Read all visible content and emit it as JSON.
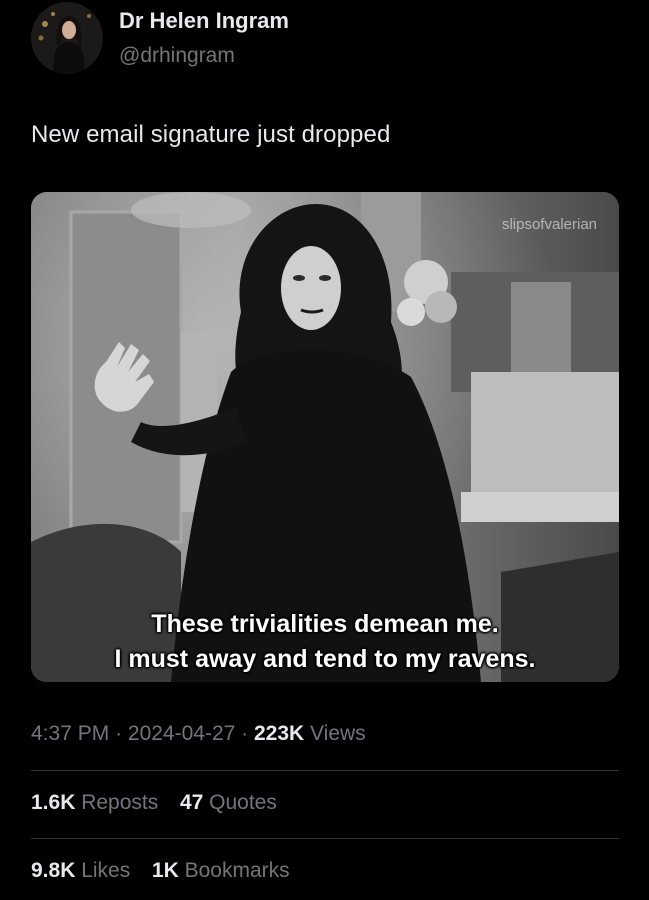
{
  "author": {
    "display_name": "Dr Helen Ingram",
    "handle": "@drhingram"
  },
  "tweet": {
    "text": "New email signature just dropped",
    "media": {
      "watermark": "slipsofvalerian",
      "caption_line1": "These trivialities demean me.",
      "caption_line2": "I must away and tend to my ravens."
    },
    "time": "4:37 PM",
    "date": "2024-04-27",
    "views_count": "223K",
    "views_label": "Views"
  },
  "stats": {
    "reposts_count": "1.6K",
    "reposts_label": "Reposts",
    "quotes_count": "47",
    "quotes_label": "Quotes",
    "likes_count": "9.8K",
    "likes_label": "Likes",
    "bookmarks_count": "1K",
    "bookmarks_label": "Bookmarks"
  }
}
